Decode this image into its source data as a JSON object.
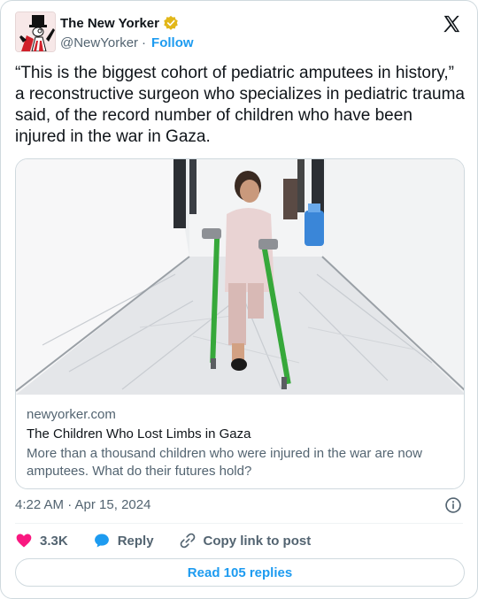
{
  "author": {
    "name": "The New Yorker",
    "handle": "@NewYorker",
    "separator": "·",
    "follow_label": "Follow"
  },
  "tweet": {
    "text": "“This is the biggest cohort of pediatric amputees in history,” a reconstructive surgeon who specializes in pediatric trauma said, of the record number of children who have been injured in the war in Gaza."
  },
  "link_card": {
    "domain": "newyorker.com",
    "title": "The Children Who Lost Limbs in Gaza",
    "description": "More than a thousand children who were injured in the war are now amputees. What do their futures hold?"
  },
  "meta": {
    "timestamp": "4:22 AM · Apr 15, 2024"
  },
  "actions": {
    "likes_count": "3.3K",
    "reply_label": "Reply",
    "copy_label": "Copy link to post"
  },
  "replies_button": {
    "label": "Read 105 replies"
  },
  "colors": {
    "accent": "#1d9bf0",
    "like": "#f91880",
    "muted_text": "#536471",
    "verified_gold": "#e2b719"
  },
  "icons": [
    "new-yorker-avatar",
    "verified-badge-icon",
    "x-logo-icon",
    "info-icon",
    "heart-icon",
    "reply-bubble-icon",
    "link-icon"
  ]
}
